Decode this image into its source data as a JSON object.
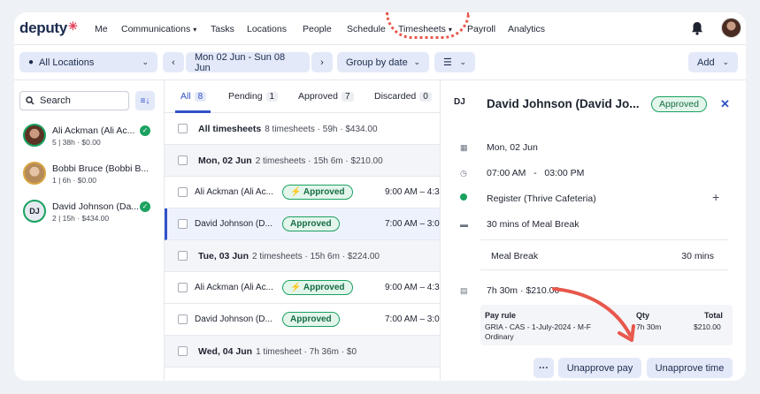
{
  "brand": {
    "logo": "deputy",
    "logo_mark": "✳"
  },
  "nav": {
    "items": [
      "Me",
      "Communications",
      "Tasks",
      "Locations",
      "People",
      "Schedule",
      "Timesheets",
      "Payroll",
      "Analytics"
    ]
  },
  "toolbar": {
    "location": "All Locations",
    "date_range": "Mon 02 Jun - Sun 08 Jun",
    "group_by": "Group by date",
    "add": "Add"
  },
  "sidebar": {
    "search_label": "Search",
    "employees": [
      {
        "name": "Ali Ackman (Ali Ac...",
        "sub": "5 | 38h · $0.00",
        "approved": true
      },
      {
        "name": "Bobbi Bruce (Bobbi B...",
        "sub": "1 | 6h · $0.00",
        "approved": false
      },
      {
        "name": "David Johnson (Da...",
        "sub": "2 | 15h · $434.00",
        "approved": true,
        "initials": "DJ"
      }
    ]
  },
  "tabs": [
    {
      "label": "All",
      "count": "8"
    },
    {
      "label": "Pending",
      "count": "1"
    },
    {
      "label": "Approved",
      "count": "7"
    },
    {
      "label": "Discarded",
      "count": "0"
    }
  ],
  "list": {
    "all_title": "All timesheets",
    "all_meta": "8 timesheets · 59h · $434.00",
    "groups": [
      {
        "date": "Mon, 02 Jun",
        "meta": "2 timesheets · 15h 6m · $210.00",
        "rows": [
          {
            "name": "Ali Ackman (Ali Ac...",
            "status": "⚡ Approved",
            "time": "9:00 AM – 4:3"
          },
          {
            "name": "David Johnson (D...",
            "status": "Approved",
            "time": "7:00 AM – 3:0"
          }
        ]
      },
      {
        "date": "Tue, 03 Jun",
        "meta": "2 timesheets · 15h 6m · $224.00",
        "rows": [
          {
            "name": "Ali Ackman (Ali Ac...",
            "status": "⚡ Approved",
            "time": "9:00 AM – 4:3"
          },
          {
            "name": "David Johnson (D...",
            "status": "Approved",
            "time": "7:00 AM – 3:0"
          }
        ]
      },
      {
        "date": "Wed, 04 Jun",
        "meta": "1 timesheet · 7h 36m · $0"
      }
    ]
  },
  "detail": {
    "initials": "DJ",
    "name": "David Johnson (David Jo...",
    "status": "Approved",
    "close": "✕",
    "date": "Mon, 02 Jun",
    "start": "07:00 AM",
    "dash": "-",
    "end": "03:00 PM",
    "area": "Register (Thrive Cafeteria)",
    "break_summary": "30 mins of Meal Break",
    "break_label": "Meal Break",
    "break_value": "30 mins",
    "total": "7h 30m  · $210.00",
    "pay_headers": {
      "rule": "Pay rule",
      "qty": "Qty",
      "total": "Total"
    },
    "pay_row": {
      "rule": "GRIA - CAS - 1-July-2024 - M-F Ordinary",
      "qty": "7h 30m",
      "total": "$210.00"
    },
    "more": "···",
    "unapprove_pay": "Unapprove pay",
    "unapprove_time": "Unapprove time"
  },
  "colors": {
    "accent": "#3252c8",
    "approved_green": "#1aa160",
    "annotation": "#e8584c"
  },
  "icons": [
    "pin-icon",
    "chevron-left-icon",
    "chevron-right-icon",
    "chevron-down-icon",
    "bell-icon",
    "search-icon",
    "sort-icon",
    "calendar-icon",
    "clock-icon",
    "area-dot-icon",
    "break-icon",
    "money-icon",
    "close-icon",
    "plus-icon"
  ]
}
